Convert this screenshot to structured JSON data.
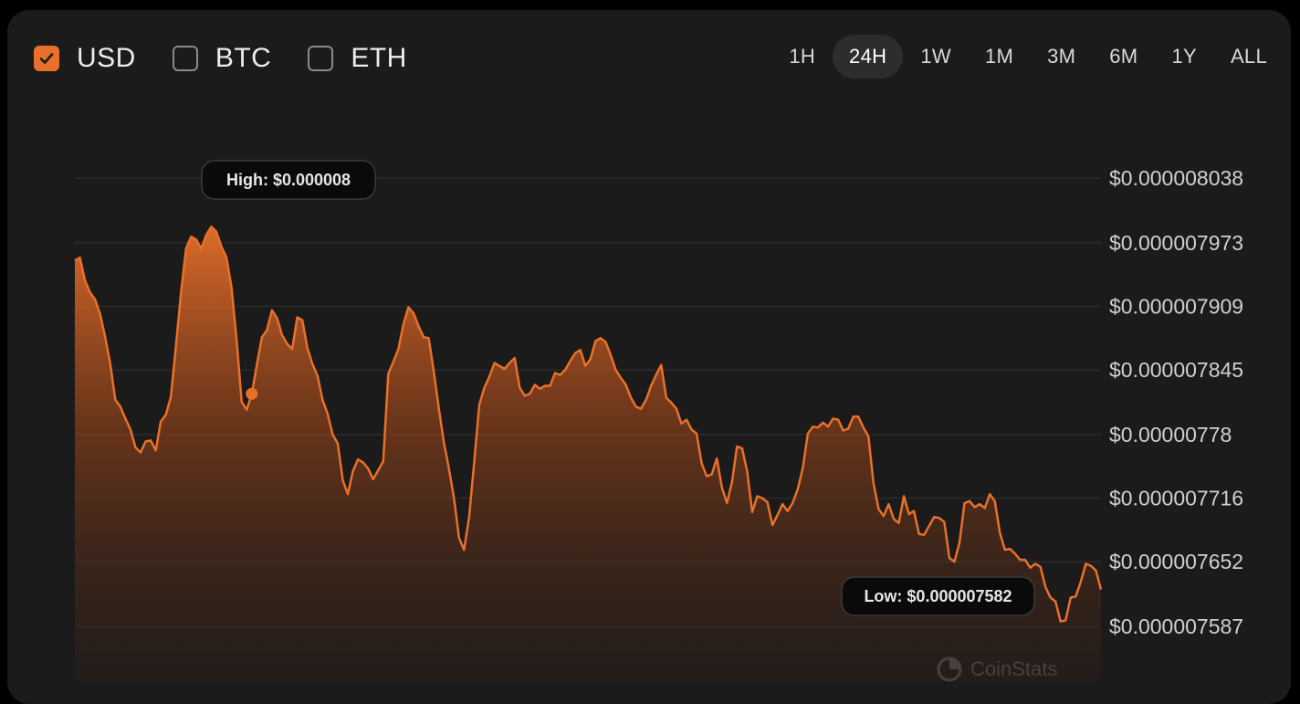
{
  "currencies": [
    {
      "label": "USD",
      "checked": true
    },
    {
      "label": "BTC",
      "checked": false
    },
    {
      "label": "ETH",
      "checked": false
    }
  ],
  "ranges": [
    {
      "label": "1H",
      "active": false
    },
    {
      "label": "24H",
      "active": true
    },
    {
      "label": "1W",
      "active": false
    },
    {
      "label": "1M",
      "active": false
    },
    {
      "label": "3M",
      "active": false
    },
    {
      "label": "6M",
      "active": false
    },
    {
      "label": "1Y",
      "active": false
    },
    {
      "label": "ALL",
      "active": false
    }
  ],
  "colors": {
    "accent": "#e8702a",
    "background": "#1b1b1b",
    "grid": "#2b2b2b",
    "text": "#d0d0d0"
  },
  "watermark": "CoinStats",
  "chart_data": {
    "type": "area",
    "y_tick_labels": [
      "$0.000008038",
      "$0.000007973",
      "$0.000007909",
      "$0.000007845",
      "$0.00000778",
      "$0.000007716",
      "$0.000007652",
      "$0.000007587"
    ],
    "y_ticks": [
      8.038e-06,
      7.973e-06,
      7.909e-06,
      7.845e-06,
      7.78e-06,
      7.716e-06,
      7.652e-06,
      7.587e-06
    ],
    "ylim": [
      7.587e-06,
      8.038e-06
    ],
    "grid": true,
    "high_label": "High: $0.000008",
    "low_label": "Low: $0.000007582",
    "high_index": 35,
    "low_index": 308,
    "values": [
      7955,
      7958,
      7935,
      7923,
      7916,
      7901,
      7878,
      7851,
      7815,
      7808,
      7796,
      7785,
      7767,
      7762,
      7773,
      7774,
      7764,
      7793,
      7800,
      7818,
      7869,
      7923,
      7967,
      7979,
      7976,
      7967,
      7981,
      7989,
      7984,
      7969,
      7958,
      7928,
      7875,
      7813,
      7805,
      7821,
      7850,
      7878,
      7885,
      7905,
      7897,
      7880,
      7871,
      7866,
      7898,
      7895,
      7867,
      7851,
      7839,
      7815,
      7801,
      7780,
      7771,
      7734,
      7720,
      7743,
      7755,
      7752,
      7746,
      7735,
      7744,
      7753,
      7841,
      7853,
      7866,
      7891,
      7908,
      7902,
      7889,
      7878,
      7877,
      7844,
      7806,
      7772,
      7746,
      7716,
      7676,
      7664,
      7697,
      7752,
      7810,
      7827,
      7838,
      7852,
      7849,
      7846,
      7852,
      7857,
      7827,
      7819,
      7821,
      7830,
      7826,
      7829,
      7829,
      7842,
      7840,
      7845,
      7854,
      7862,
      7865,
      7849,
      7856,
      7874,
      7877,
      7873,
      7860,
      7845,
      7837,
      7830,
      7817,
      7808,
      7806,
      7815,
      7829,
      7840,
      7850,
      7817,
      7812,
      7806,
      7791,
      7795,
      7785,
      7781,
      7751,
      7738,
      7740,
      7756,
      7727,
      7711,
      7732,
      7768,
      7766,
      7743,
      7702,
      7718,
      7716,
      7712,
      7689,
      7699,
      7710,
      7703,
      7711,
      7725,
      7746,
      7781,
      7788,
      7787,
      7792,
      7788,
      7796,
      7795,
      7784,
      7786,
      7798,
      7798,
      7787,
      7778,
      7731,
      7705,
      7698,
      7710,
      7695,
      7691,
      7718,
      7700,
      7703,
      7680,
      7679,
      7688,
      7697,
      7696,
      7692,
      7656,
      7652,
      7671,
      7711,
      7713,
      7707,
      7710,
      7706,
      7720,
      7713,
      7681,
      7664,
      7665,
      7660,
      7654,
      7654,
      7646,
      7650,
      7647,
      7627,
      7616,
      7612,
      7592,
      7593,
      7616,
      7617,
      7632,
      7650,
      7648,
      7643,
      7624
    ],
    "smoothing": "display"
  }
}
